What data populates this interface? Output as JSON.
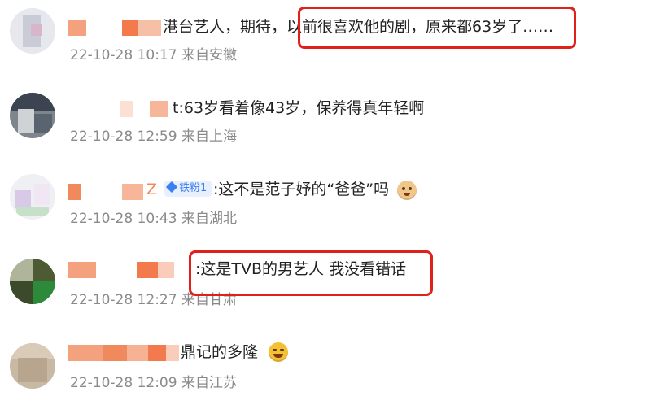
{
  "comments": [
    {
      "text": "港台艺人，期待，以前很喜欢他的剧，原来都63岁了……",
      "meta": "22-10-28 10:17 来自安徽",
      "highlighted": "以前很喜欢他的剧，原来都63岁了……"
    },
    {
      "text": "t:63岁看着像43岁，保养得真年轻啊",
      "meta": "22-10-28 12:59 来自上海"
    },
    {
      "name_tail": "Z",
      "badge": "铁粉1",
      "text": ":这不是范子妤的“爸爸”吗",
      "meta": "22-10-28 10:43 来自湖北",
      "emoji": "doge-icon"
    },
    {
      "text": ":这是TVB的男艺人  我没看错话",
      "meta": "22-10-28 12:27 来自甘肃",
      "highlighted": ":这是TVB的男艺人  我没看错话"
    },
    {
      "text": "鼎记的多隆",
      "meta": "22-10-28 12:09 来自江苏",
      "emoji": "laughing-tears-icon"
    }
  ],
  "colors": {
    "highlight_border": "#e0201a",
    "mosaic": "#f08a5d",
    "badge_bg": "#e8f0fe",
    "badge_text": "#3d7ef0",
    "meta_text": "#8a8a8a"
  }
}
